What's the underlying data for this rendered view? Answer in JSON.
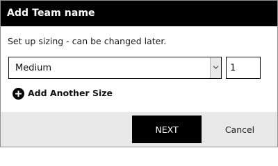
{
  "dialog": {
    "title": "Add Team name",
    "subtitle": "Set up sizing - can be changed later."
  },
  "size_select": {
    "selected": "Medium",
    "arrow_icon": "chevron-down-icon"
  },
  "quantity": {
    "value": "1"
  },
  "add_size": {
    "icon": "plus-circle-icon",
    "label": "Add Another Size"
  },
  "footer": {
    "next_label": "NEXT",
    "cancel_label": "Cancel"
  },
  "colors": {
    "header_bg": "#000000",
    "primary_button_bg": "#000000",
    "footer_bg": "#e8e8e8"
  }
}
